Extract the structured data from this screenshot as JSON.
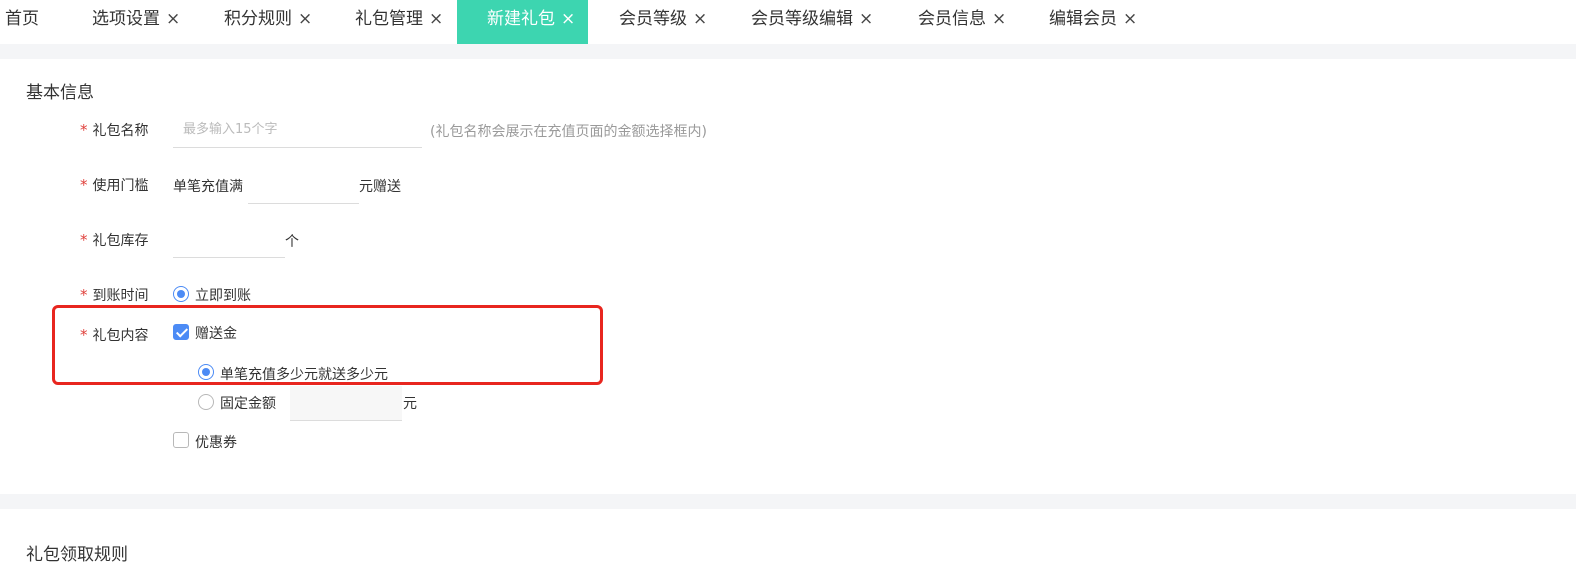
{
  "tabs": [
    {
      "label": "首页",
      "closable": false
    },
    {
      "label": "选项设置",
      "closable": true
    },
    {
      "label": "积分规则",
      "closable": true
    },
    {
      "label": "礼包管理",
      "closable": true
    },
    {
      "label": "新建礼包",
      "closable": true,
      "active": true
    },
    {
      "label": "会员等级",
      "closable": true
    },
    {
      "label": "会员等级编辑",
      "closable": true
    },
    {
      "label": "会员信息",
      "closable": true
    },
    {
      "label": "编辑会员",
      "closable": true
    }
  ],
  "close_glyph": "×",
  "basic_section": {
    "title": "基本信息",
    "required_mark": "*",
    "name_field": {
      "label": "礼包名称",
      "placeholder": "最多输入15个字",
      "value": "",
      "hint": "(礼包名称会展示在充值页面的金额选择框内)"
    },
    "threshold_field": {
      "label": "使用门槛",
      "prefix": "单笔充值满",
      "value": "",
      "suffix": "元赠送"
    },
    "stock_field": {
      "label": "礼包库存",
      "value": "",
      "suffix": "个"
    },
    "arrival_field": {
      "label": "到账时间",
      "option": "立即到账",
      "selected": true
    },
    "content_field": {
      "label": "礼包内容",
      "gift_money": {
        "label": "赠送金",
        "checked": true
      },
      "gift_options": [
        {
          "label": "单笔充值多少元就送多少元",
          "selected": true
        },
        {
          "label": "固定金额",
          "selected": false,
          "value": "",
          "suffix": "元"
        }
      ],
      "coupon": {
        "label": "优惠券",
        "checked": false
      }
    }
  },
  "rules_section": {
    "title": "礼包领取规则"
  },
  "colors": {
    "active_tab": "#3dd5b0",
    "primary": "#4c8bf5",
    "required": "#e0413c",
    "highlight_border": "#e8261f"
  }
}
